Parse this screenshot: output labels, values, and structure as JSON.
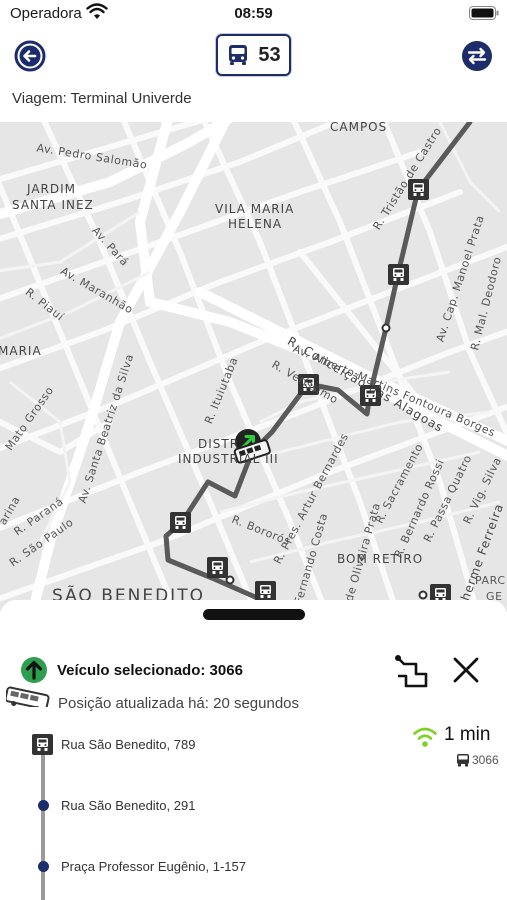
{
  "status_bar": {
    "carrier": "Operadora",
    "time": "08:59"
  },
  "header": {
    "line_number": "53",
    "trip_label": "Viagem: Terminal Univerde"
  },
  "map": {
    "labels": {
      "campos": "CAMPOS",
      "av_pedro_salomao": "Av. Pedro Salomão",
      "jardim": "JARDIM",
      "santa_inez": "SANTA INEZ",
      "vila_maria": "VILA MARIA",
      "helena": "HELENA",
      "r_tristao_de_castro": "R. Tristão de Castro",
      "av_para": "Av. Pará",
      "av_maranhao": "Av. Maranhão",
      "r_piaui": "R. Piauí",
      "maria": "MARIA",
      "av_alberto_martins": "Av. Alberto Martins Fontoura Borges",
      "av_cap_manoel_prata": "Av. Cap. Manoel Prata",
      "r_mal_deodoro": "R. Mal. Deodoro",
      "r_conceicao_das_alagoas": "R. Conceição das Alagoas",
      "r_ituiutaba": "R. Ituiutaba",
      "r_verissimo": "R. Veríssimo",
      "distrito": "DISTR",
      "industrial": "INDUSTRIAL III",
      "av_santa_beatriz": "Av. Santa Beatriz da Silva",
      "mato_grosso": "Mato Grosso",
      "r_parana": "R. Paraná",
      "r_sao_paulo": "R. São Paulo",
      "arina": "arina",
      "r_bororos": "R. Bororós",
      "r_pres_artur_bernardes": "R. Pres. Artur Bernardes",
      "fernando_costa": "Fernando Costa",
      "joaquim_oliveira_prata": "quim de Oliveira Prata",
      "r_sacramento": "R. Sacramento",
      "r_bernardo_rossi": "R. Bernardo Rossi",
      "r_passa_quatro": "R. Passa Quatro",
      "r_vig_silva": "R. Vig. Silva",
      "bom_retiro": "BOM RETIRO",
      "sao_benedito": "SÃO BENEDITO",
      "guilherme_ferreira": "lherme Ferreira",
      "parc": "PARC",
      "ge": "GE"
    }
  },
  "vehicle": {
    "selected_label": "Veículo selecionado: 3066",
    "updated_label": "Posição atualizada há: 20 segundos"
  },
  "eta": {
    "time": "1 min",
    "vehicle": "3066",
    "signal_color": "#7ed321"
  },
  "stops": [
    {
      "name": "Rua São Benedito, 789"
    },
    {
      "name": "Rua São Benedito, 291"
    },
    {
      "name": "Praça Professor Eugênio, 1-157"
    }
  ],
  "colors": {
    "primary": "#1d2d6b",
    "route": "#555555",
    "accent": "#2e9e4f"
  }
}
